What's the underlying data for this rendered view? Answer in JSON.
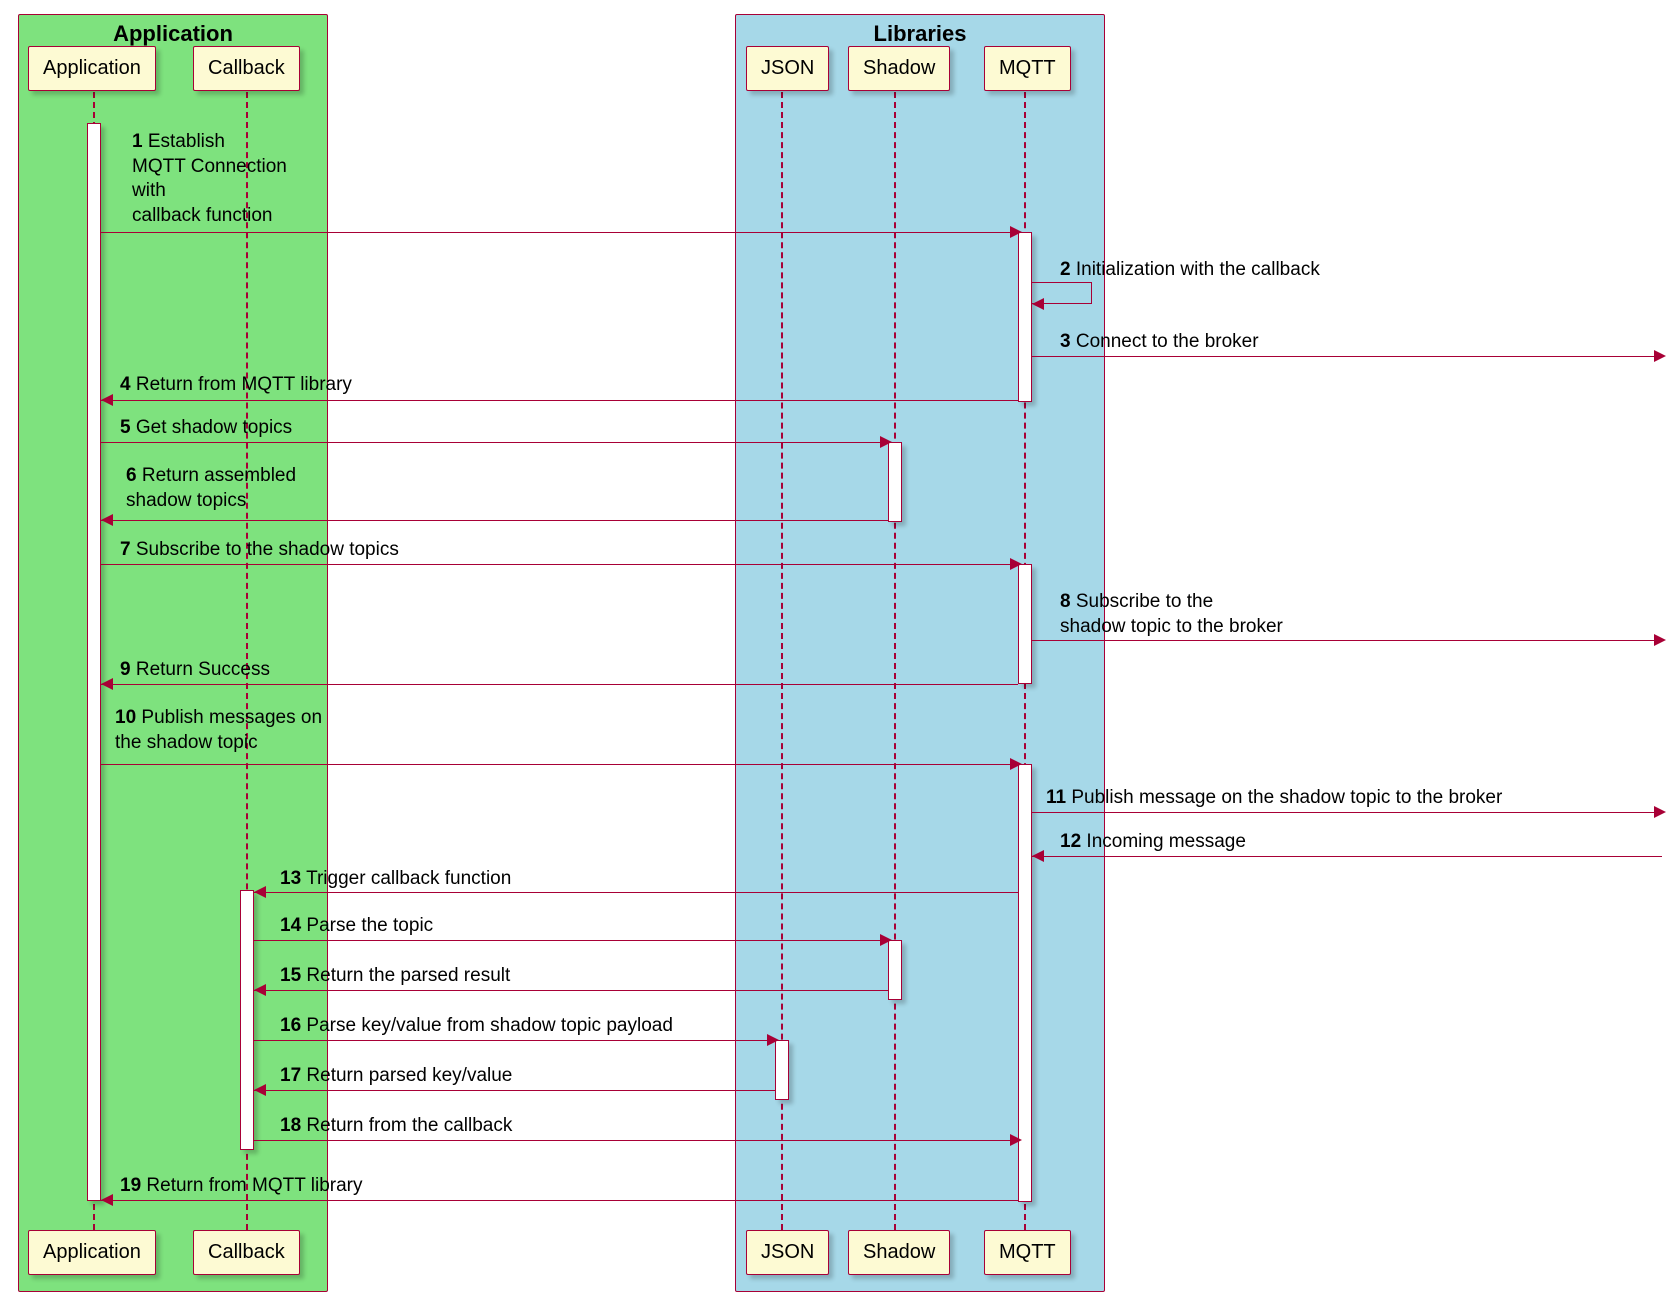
{
  "groups": {
    "app": {
      "title": "Application"
    },
    "lib": {
      "title": "Libraries"
    }
  },
  "participants": {
    "application": "Application",
    "callback": "Callback",
    "json": "JSON",
    "shadow": "Shadow",
    "mqtt": "MQTT"
  },
  "messages": [
    {
      "n": "1",
      "text": "Establish\nMQTT Connection\nwith\ncallback function"
    },
    {
      "n": "2",
      "text": "Initialization with the callback"
    },
    {
      "n": "3",
      "text": "Connect to the broker"
    },
    {
      "n": "4",
      "text": "Return from MQTT library"
    },
    {
      "n": "5",
      "text": "Get shadow topics"
    },
    {
      "n": "6",
      "text": "Return assembled\nshadow topics"
    },
    {
      "n": "7",
      "text": "Subscribe to the shadow topics"
    },
    {
      "n": "8",
      "text": "Subscribe to the\nshadow topic to the broker"
    },
    {
      "n": "9",
      "text": "Return Success"
    },
    {
      "n": "10",
      "text": "Publish messages on\nthe shadow topic"
    },
    {
      "n": "11",
      "text": "Publish message on the shadow topic to the broker"
    },
    {
      "n": "12",
      "text": "Incoming message"
    },
    {
      "n": "13",
      "text": "Trigger callback function"
    },
    {
      "n": "14",
      "text": "Parse the topic"
    },
    {
      "n": "15",
      "text": "Return the parsed result"
    },
    {
      "n": "16",
      "text": "Parse key/value from shadow topic payload"
    },
    {
      "n": "17",
      "text": "Return parsed key/value"
    },
    {
      "n": "18",
      "text": "Return from the callback"
    },
    {
      "n": "19",
      "text": "Return from MQTT library"
    }
  ],
  "colors": {
    "line": "#a80036",
    "participant_fill": "#fdfad3",
    "group_app_fill": "#7ee27e",
    "group_lib_fill": "#a6d8e8"
  }
}
